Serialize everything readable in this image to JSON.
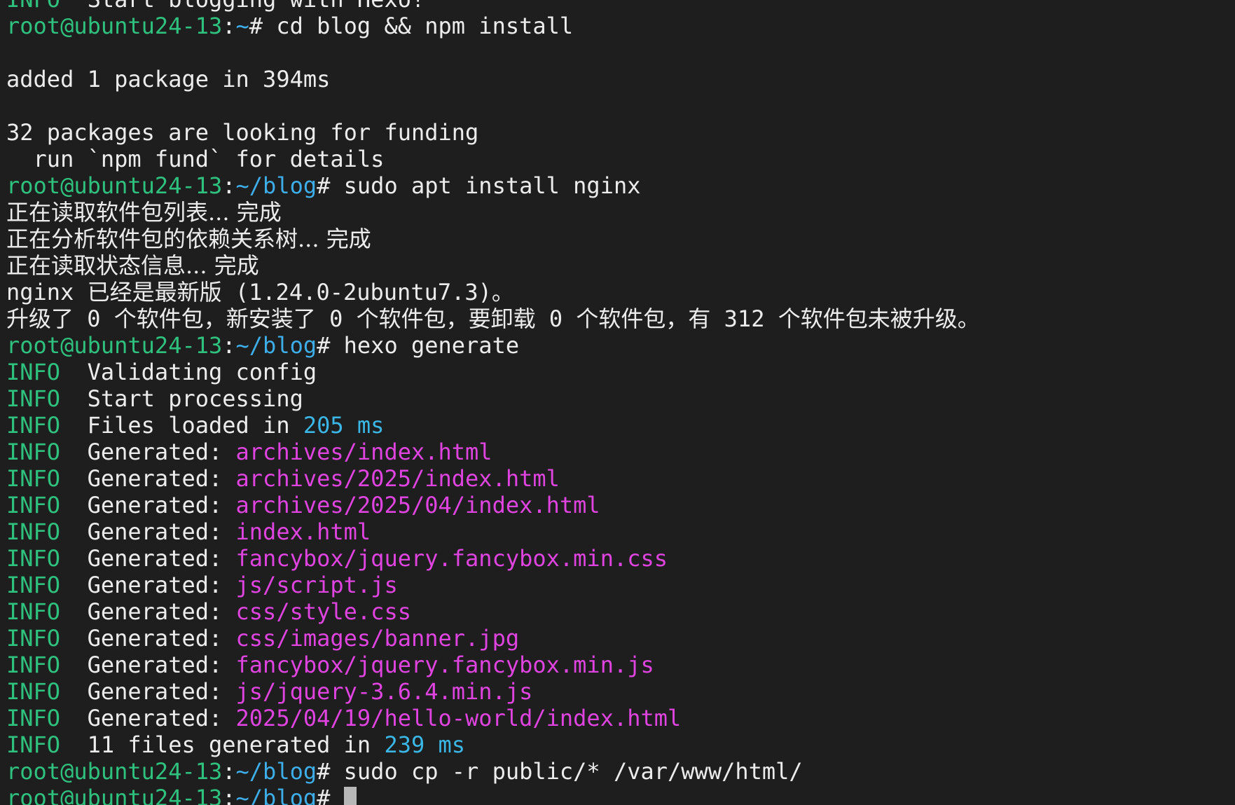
{
  "theme": {
    "background": "#1e1e1e",
    "prompt_user_color": "#2ec27e",
    "prompt_path_color": "#3daee9",
    "info_color": "#2ec27e",
    "file_color": "#e044e0",
    "timing_color": "#3ab7e6",
    "text_color": "#ececec"
  },
  "lines": [
    [
      {
        "t": "INFO",
        "c": "green"
      },
      {
        "t": "  Start blogging with Hexo!",
        "c": "white"
      }
    ],
    [
      {
        "t": "root@ubuntu24-13",
        "c": "green"
      },
      {
        "t": ":",
        "c": "white"
      },
      {
        "t": "~",
        "c": "blue"
      },
      {
        "t": "# cd blog && npm install",
        "c": "white"
      }
    ],
    [],
    [
      {
        "t": "added 1 package in 394ms",
        "c": "white"
      }
    ],
    [],
    [
      {
        "t": "32 packages are looking for funding",
        "c": "white"
      }
    ],
    [
      {
        "t": "  run `npm fund` for details",
        "c": "white"
      }
    ],
    [
      {
        "t": "root@ubuntu24-13",
        "c": "green"
      },
      {
        "t": ":",
        "c": "white"
      },
      {
        "t": "~/blog",
        "c": "blue"
      },
      {
        "t": "# sudo apt install nginx",
        "c": "white"
      }
    ],
    [
      {
        "t": "正在读取软件包列表... 完成",
        "c": "cjk"
      }
    ],
    [
      {
        "t": "正在分析软件包的依赖关系树... 完成",
        "c": "cjk"
      }
    ],
    [
      {
        "t": "正在读取状态信息... 完成",
        "c": "cjk"
      }
    ],
    [
      {
        "t": "nginx 已经是最新版 (1.24.0-2ubuntu7.3)。",
        "c": "white"
      }
    ],
    [
      {
        "t": "升级了 0 个软件包，新安装了 0 个软件包，要卸载 0 个软件包，有 312 个软件包未被升级。",
        "c": "white"
      }
    ],
    [
      {
        "t": "root@ubuntu24-13",
        "c": "green"
      },
      {
        "t": ":",
        "c": "white"
      },
      {
        "t": "~/blog",
        "c": "blue"
      },
      {
        "t": "# hexo generate",
        "c": "white"
      }
    ],
    [
      {
        "t": "INFO",
        "c": "green"
      },
      {
        "t": "  Validating config",
        "c": "white"
      }
    ],
    [
      {
        "t": "INFO",
        "c": "green"
      },
      {
        "t": "  Start processing",
        "c": "white"
      }
    ],
    [
      {
        "t": "INFO",
        "c": "green"
      },
      {
        "t": "  Files loaded in ",
        "c": "white"
      },
      {
        "t": "205 ms",
        "c": "cyan"
      }
    ],
    [
      {
        "t": "INFO",
        "c": "green"
      },
      {
        "t": "  Generated: ",
        "c": "white"
      },
      {
        "t": "archives/index.html",
        "c": "magenta"
      }
    ],
    [
      {
        "t": "INFO",
        "c": "green"
      },
      {
        "t": "  Generated: ",
        "c": "white"
      },
      {
        "t": "archives/2025/index.html",
        "c": "magenta"
      }
    ],
    [
      {
        "t": "INFO",
        "c": "green"
      },
      {
        "t": "  Generated: ",
        "c": "white"
      },
      {
        "t": "archives/2025/04/index.html",
        "c": "magenta"
      }
    ],
    [
      {
        "t": "INFO",
        "c": "green"
      },
      {
        "t": "  Generated: ",
        "c": "white"
      },
      {
        "t": "index.html",
        "c": "magenta"
      }
    ],
    [
      {
        "t": "INFO",
        "c": "green"
      },
      {
        "t": "  Generated: ",
        "c": "white"
      },
      {
        "t": "fancybox/jquery.fancybox.min.css",
        "c": "magenta"
      }
    ],
    [
      {
        "t": "INFO",
        "c": "green"
      },
      {
        "t": "  Generated: ",
        "c": "white"
      },
      {
        "t": "js/script.js",
        "c": "magenta"
      }
    ],
    [
      {
        "t": "INFO",
        "c": "green"
      },
      {
        "t": "  Generated: ",
        "c": "white"
      },
      {
        "t": "css/style.css",
        "c": "magenta"
      }
    ],
    [
      {
        "t": "INFO",
        "c": "green"
      },
      {
        "t": "  Generated: ",
        "c": "white"
      },
      {
        "t": "css/images/banner.jpg",
        "c": "magenta"
      }
    ],
    [
      {
        "t": "INFO",
        "c": "green"
      },
      {
        "t": "  Generated: ",
        "c": "white"
      },
      {
        "t": "fancybox/jquery.fancybox.min.js",
        "c": "magenta"
      }
    ],
    [
      {
        "t": "INFO",
        "c": "green"
      },
      {
        "t": "  Generated: ",
        "c": "white"
      },
      {
        "t": "js/jquery-3.6.4.min.js",
        "c": "magenta"
      }
    ],
    [
      {
        "t": "INFO",
        "c": "green"
      },
      {
        "t": "  Generated: ",
        "c": "white"
      },
      {
        "t": "2025/04/19/hello-world/index.html",
        "c": "magenta"
      }
    ],
    [
      {
        "t": "INFO",
        "c": "green"
      },
      {
        "t": "  11 files generated in ",
        "c": "white"
      },
      {
        "t": "239 ms",
        "c": "cyan"
      }
    ],
    [
      {
        "t": "root@ubuntu24-13",
        "c": "green"
      },
      {
        "t": ":",
        "c": "white"
      },
      {
        "t": "~/blog",
        "c": "blue"
      },
      {
        "t": "# sudo cp -r public/* /var/www/html/",
        "c": "white"
      }
    ],
    [
      {
        "t": "root@ubuntu24-13",
        "c": "green"
      },
      {
        "t": ":",
        "c": "white"
      },
      {
        "t": "~/blog",
        "c": "blue"
      },
      {
        "t": "# ",
        "c": "white"
      },
      {
        "t": "",
        "c": "cursor"
      }
    ]
  ]
}
